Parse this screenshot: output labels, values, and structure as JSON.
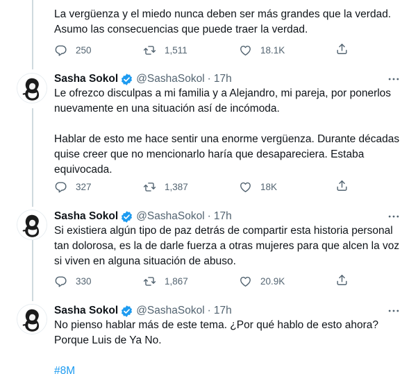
{
  "top_tweet": {
    "text_lines": [
      "La vergüenza y el miedo nunca deben ser más grandes que la verdad.",
      "Asumo las consecuencias que puede traer la verdad."
    ],
    "replies": "250",
    "retweets": "1,511",
    "likes": "18.1K"
  },
  "author": {
    "name": "Sasha Sokol",
    "handle": "@SashaSokol",
    "dot": "·"
  },
  "tweets": [
    {
      "time": "17h",
      "paragraphs": [
        "Le ofrezco disculpas a mi familia y a Alejandro, mi pareja, por ponerlos nuevamente en una situación así de incómoda.",
        "Hablar de esto me hace sentir una enorme vergüenza. Durante décadas quise creer que no mencionarlo haría que desapareciera. Estaba equivocada."
      ],
      "replies": "327",
      "retweets": "1,387",
      "likes": "18K"
    },
    {
      "time": "17h",
      "paragraphs": [
        "Si existiera algún tipo de paz detrás de compartir esta historia personal tan dolorosa, es la de darle fuerza a otras mujeres para que alcen la voz si viven en alguna situación de abuso."
      ],
      "replies": "330",
      "retweets": "1,867",
      "likes": "20.9K"
    },
    {
      "time": "17h",
      "paragraphs": [
        "No pienso hablar más de este tema. ¿Por qué hablo de esto ahora? Porque Luis de Ya No."
      ],
      "hashtag": "#8M"
    }
  ],
  "colors": {
    "text": "#0f1419",
    "secondary": "#536471",
    "accent": "#1d9bf0",
    "thread_line": "#cfd9de"
  },
  "icons": {
    "reply": "reply-icon",
    "retweet": "retweet-icon",
    "like": "heart-icon",
    "share": "share-icon",
    "verified": "verified-badge-icon",
    "more": "more-options-icon"
  }
}
